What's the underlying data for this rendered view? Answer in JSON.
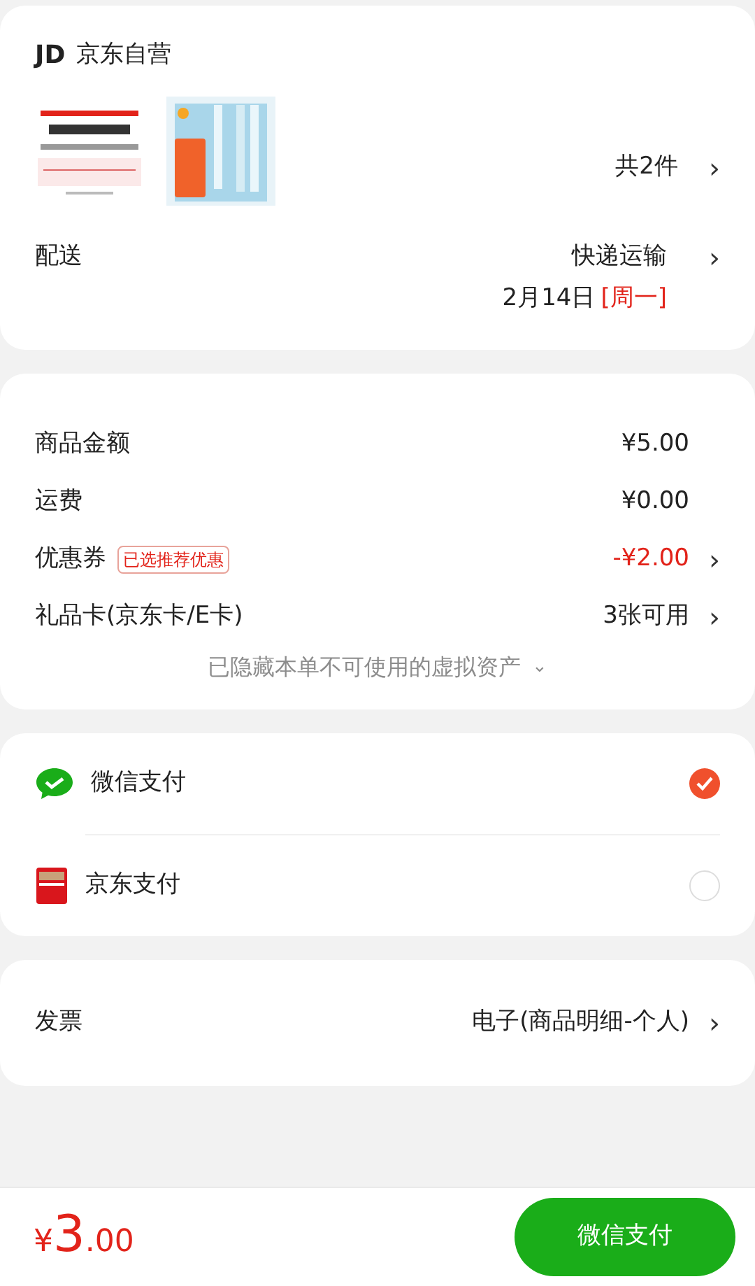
{
  "store": {
    "logo": "JD",
    "name": "京东自营"
  },
  "products": {
    "count": "共2件",
    "chevron": "›"
  },
  "delivery": {
    "label": "配送",
    "method": "快递运输",
    "chevron": "›",
    "date": "2月14日",
    "weekday": "[周一]"
  },
  "summary": [
    {
      "label": "商品金额",
      "value": "¥5.00",
      "highlight": false
    },
    {
      "label": "运费",
      "value": "¥0.00",
      "highlight": false
    },
    {
      "label": "优惠券",
      "tag": "已选推荐优惠",
      "value": "-¥2.00",
      "highlight": true,
      "chevron": "›"
    },
    {
      "label": "礼品卡(京东卡/E卡)",
      "value": "3张可用",
      "highlight": false,
      "chevron": "›"
    }
  ],
  "hidden_note": {
    "text": "已隐藏本单不可使用的虚拟资产",
    "chevron": "⌄"
  },
  "payments": [
    {
      "kind": "wechat",
      "label": "微信支付",
      "selected": true
    },
    {
      "kind": "jdpay",
      "label": "京东支付",
      "selected": false
    }
  ],
  "invoice": {
    "label": "发票",
    "value": "电子(商品明细-个人)",
    "chevron": "›"
  },
  "footer": {
    "currency": "¥",
    "integer": "3",
    "decimals": ".00",
    "pay_button": "微信支付"
  }
}
